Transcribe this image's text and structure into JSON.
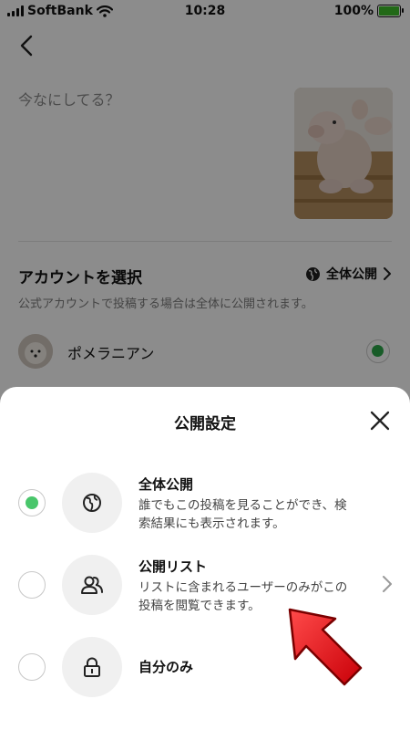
{
  "status_bar": {
    "carrier": "SoftBank",
    "time": "10:28",
    "battery": "100%"
  },
  "post": {
    "placeholder": "今なにしてる？"
  },
  "account": {
    "title": "アカウントを選択",
    "visibility_link": "全体公開",
    "note": "公式アカウントで投稿する場合は全体に公開されます。",
    "name": "ポメラニアン"
  },
  "sheet": {
    "title": "公開設定",
    "options": [
      {
        "title": "全体公開",
        "desc": "誰でもこの投稿を見ることができ、検索結果にも表示されます。",
        "selected": true,
        "icon": "globe-icon"
      },
      {
        "title": "公開リスト",
        "desc": "リストに含まれるユーザーのみがこの投稿を閲覧できます。",
        "selected": false,
        "icon": "people-icon"
      },
      {
        "title": "自分のみ",
        "desc": "",
        "selected": false,
        "icon": "lock-icon"
      }
    ]
  },
  "colors": {
    "accent_green": "#49c66b",
    "arrow_red": "#e8141e"
  }
}
